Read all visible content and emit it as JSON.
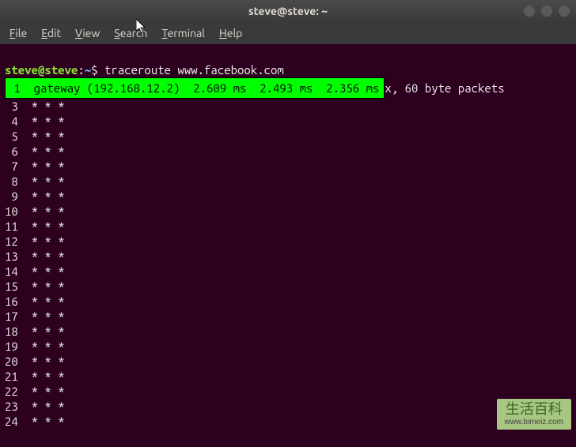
{
  "window": {
    "title": "steve@steve: ~"
  },
  "menu": {
    "file": "File",
    "edit": "Edit",
    "view": "View",
    "search": "Search",
    "terminal": "Terminal",
    "help": "Help"
  },
  "prompt": {
    "user_host": "steve@steve",
    "colon": ":",
    "path": "~",
    "dollar": "$ "
  },
  "command": "traceroute www.facebook.com",
  "info_tail": "x, 60 byte packets",
  "highlighted_hop": " 1  gateway (192.168.12.2)  2.609 ms  2.493 ms  2.356 ms",
  "hops": [
    " 3  * * *",
    " 4  * * *",
    " 5  * * *",
    " 6  * * *",
    " 7  * * *",
    " 8  * * *",
    " 9  * * *",
    "10  * * *",
    "11  * * *",
    "12  * * *",
    "13  * * *",
    "14  * * *",
    "15  * * *",
    "16  * * *",
    "17  * * *",
    "18  * * *",
    "19  * * *",
    "20  * * *",
    "21  * * *",
    "22  * * *",
    "23  * * *",
    "24  * * *"
  ],
  "watermark": {
    "main": "生活百科",
    "url": "www.bimeiz.com"
  }
}
